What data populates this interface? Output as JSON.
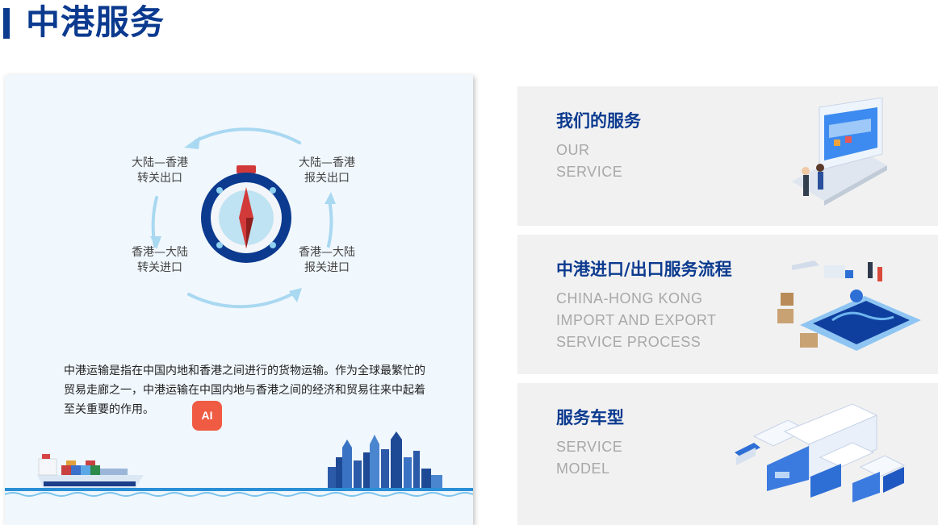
{
  "header": {
    "title": "中港服务"
  },
  "left": {
    "cycle_labels": [
      {
        "line1": "大陆—香港",
        "line2": "转关出口"
      },
      {
        "line1": "大陆—香港",
        "line2": "报关出口"
      },
      {
        "line1": "香港—大陆",
        "line2": "转关进口"
      },
      {
        "line1": "香港—大陆",
        "line2": "报关进口"
      }
    ],
    "description": "中港运输是指在中国内地和香港之间进行的货物运输。作为全球最繁忙的贸易走廊之一，中港运输在中国内地与香港之间的经济和贸易往来中起着至关重要的作用。",
    "ai_badge": "AI"
  },
  "cards": [
    {
      "title": "我们的服务",
      "sub": [
        "OUR",
        "SERVICE"
      ]
    },
    {
      "title": "中港进口/出口服务流程",
      "sub": [
        "CHINA-HONG KONG",
        "IMPORT AND EXPORT",
        "SERVICE PROCESS"
      ]
    },
    {
      "title": "服务车型",
      "sub": [
        "SERVICE",
        "MODEL"
      ]
    }
  ],
  "colors": {
    "brand": "#0b3a8f",
    "panel_bg": "#f0f7fd",
    "card_bg": "#f1f1f1",
    "ai_badge": "#ef5b43"
  }
}
